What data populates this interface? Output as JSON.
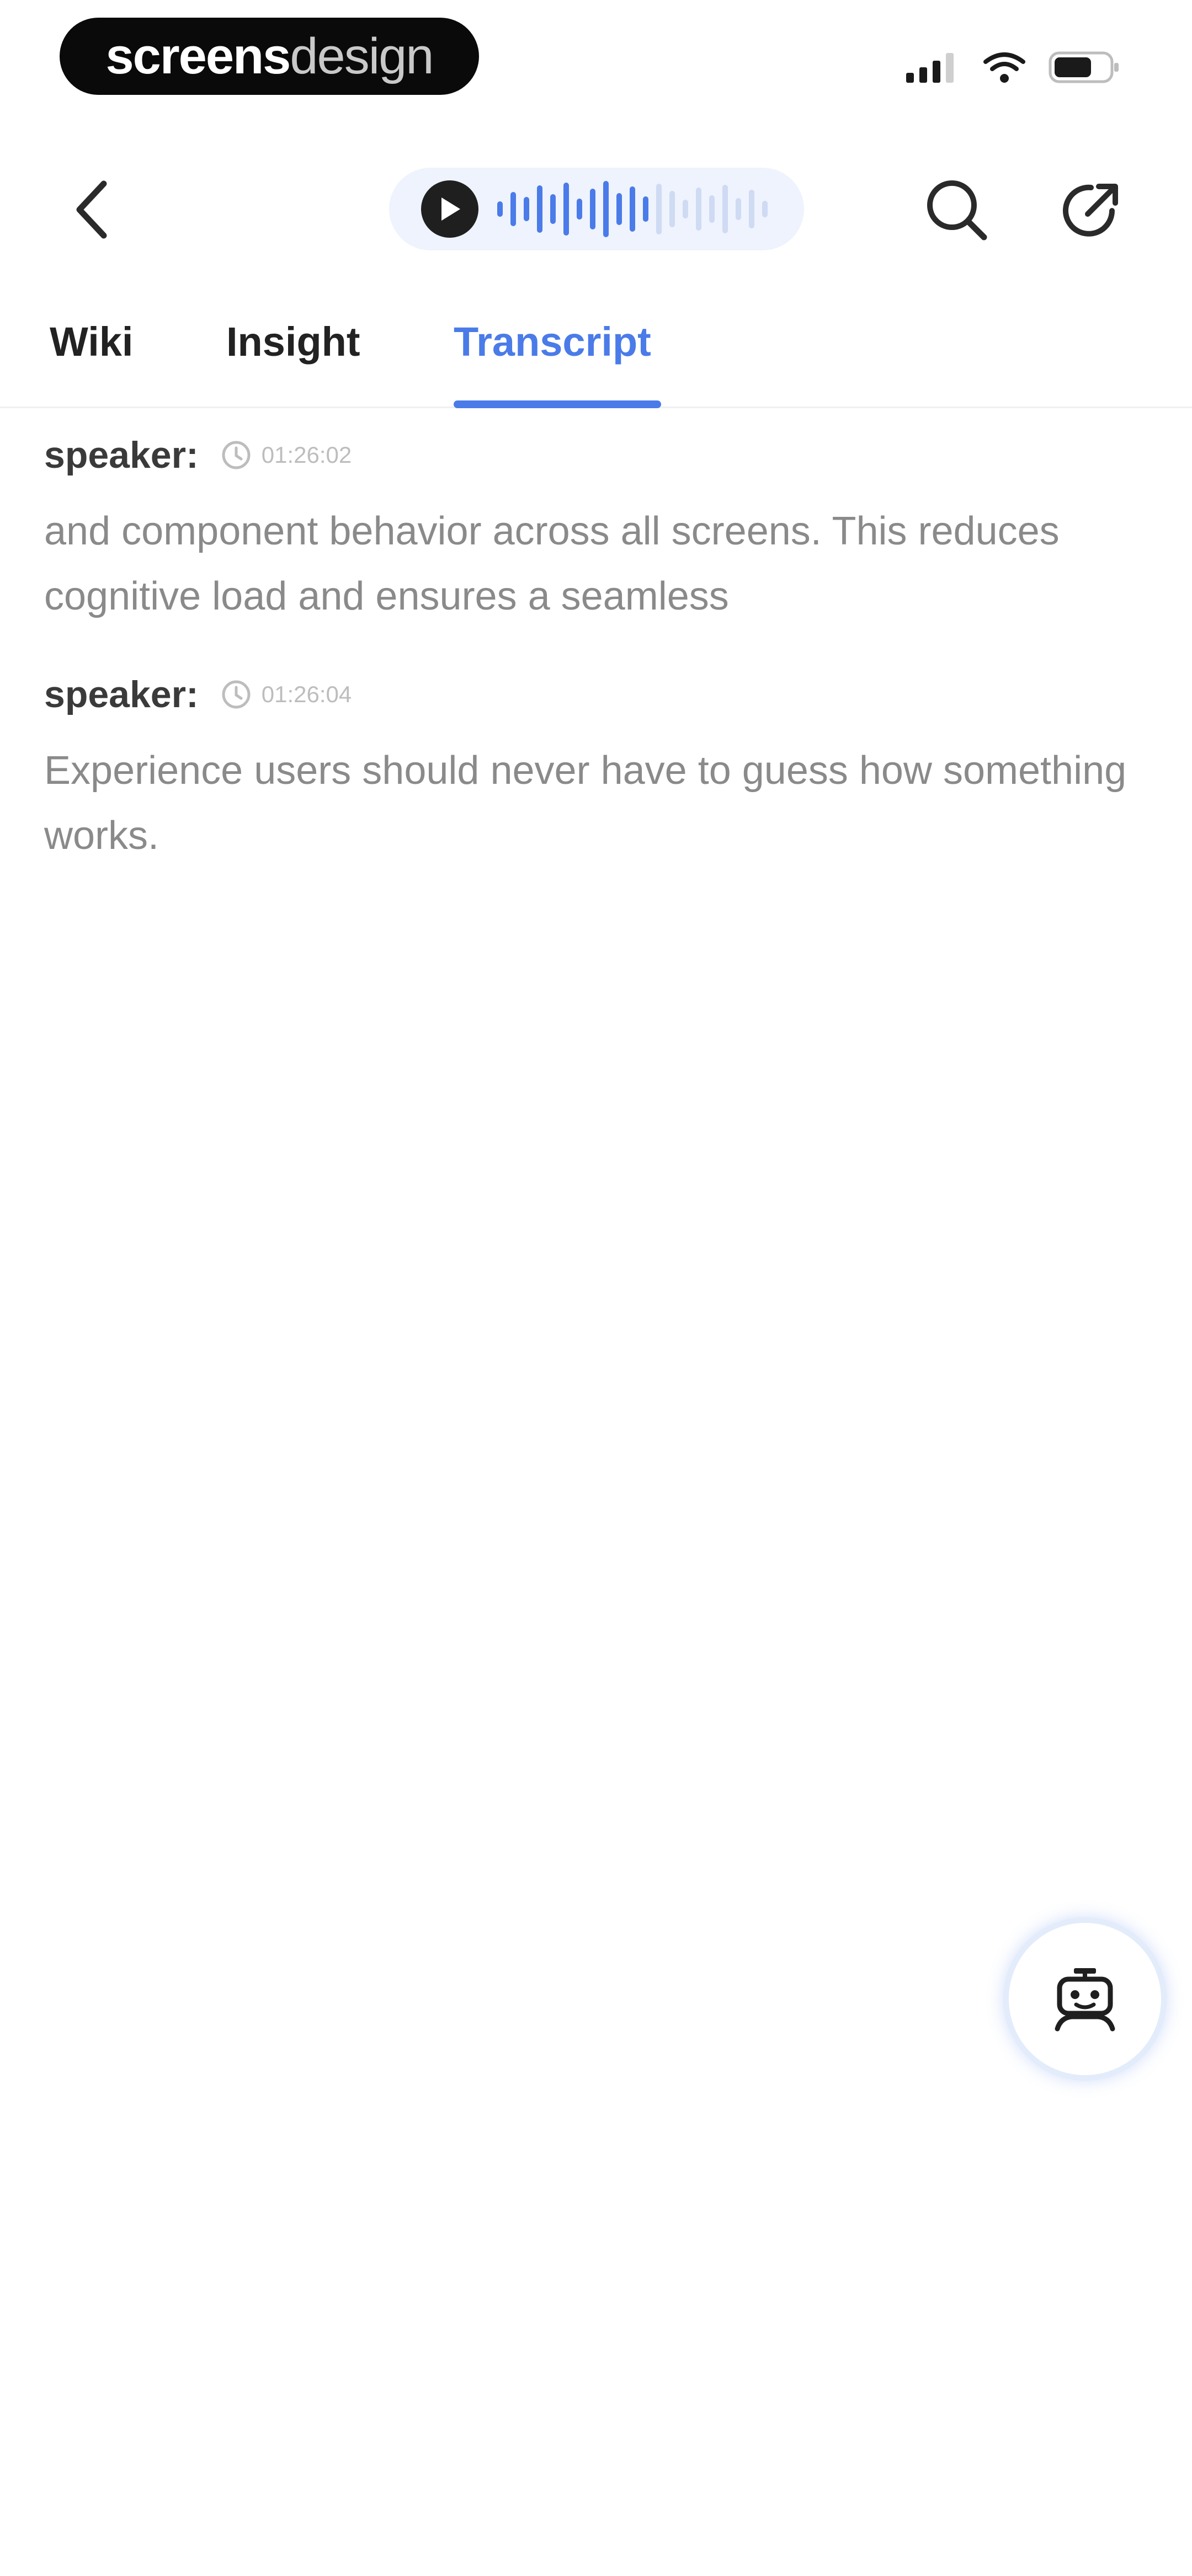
{
  "status_bar": {
    "brand_strong": "screens",
    "brand_light": "design",
    "icons": [
      "signal-icon",
      "wifi-icon",
      "battery-icon"
    ]
  },
  "header": {
    "icons": [
      "back-arrow-icon",
      "play-icon",
      "waveform-icon",
      "search-icon",
      "share-icon"
    ],
    "accent_color": "#4a7be8",
    "playback_progress": 0.55
  },
  "tabs": [
    {
      "label": "Wiki",
      "active": false
    },
    {
      "label": "Insight",
      "active": false
    },
    {
      "label": "Transcript",
      "active": true
    }
  ],
  "transcript": {
    "segments": [
      {
        "speaker": "speaker:",
        "time": "01:26:02",
        "text": "and component behavior across all screens. This reduces cognitive load and ensures a seamless"
      },
      {
        "speaker": "speaker:",
        "time": "01:26:04",
        "text": "Experience users should never have to guess how something works."
      }
    ]
  },
  "fab": {
    "icon": "robot-assistant-icon"
  }
}
